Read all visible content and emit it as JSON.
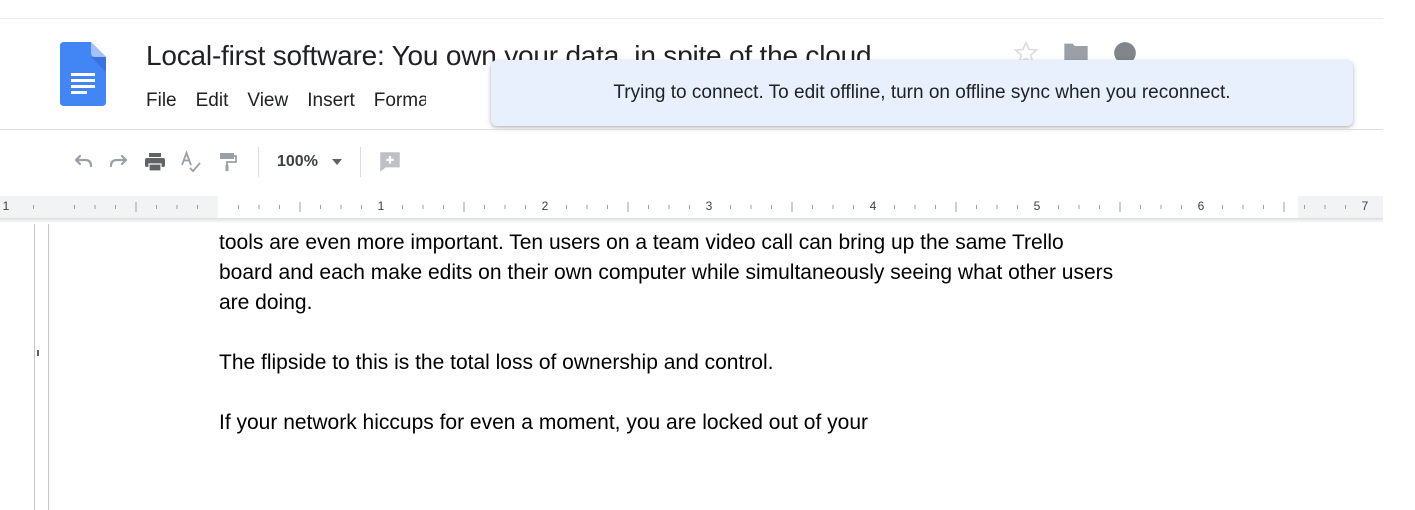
{
  "header": {
    "title": "Local-first software: You own your data, in spite of the cloud",
    "menu": [
      "File",
      "Edit",
      "View",
      "Insert",
      "Format"
    ]
  },
  "toast": {
    "message": "Trying to connect. To edit offline, turn on offline sync when you reconnect."
  },
  "toolbar": {
    "zoom": "100%",
    "icons": [
      "undo-icon",
      "redo-icon",
      "print-icon",
      "spellcheck-icon",
      "paint-format-icon",
      "add-comment-icon"
    ]
  },
  "ruler": {
    "labels": [
      "1",
      "1",
      "2",
      "3",
      "4",
      "5",
      "6",
      "7"
    ]
  },
  "document": {
    "lines": [
      "tools are even more important. Ten users on a team video call can bring up the same Trello",
      "board and each make edits on their own computer while simultaneously seeing what other users",
      "are doing.",
      "The flipside to this is the total loss of ownership and control.",
      "If your network hiccups for even a moment, you are locked out of your"
    ]
  },
  "colors": {
    "toast_bg": "#e8f0fe",
    "doc_icon": "#4285f4",
    "text": "#202124"
  }
}
